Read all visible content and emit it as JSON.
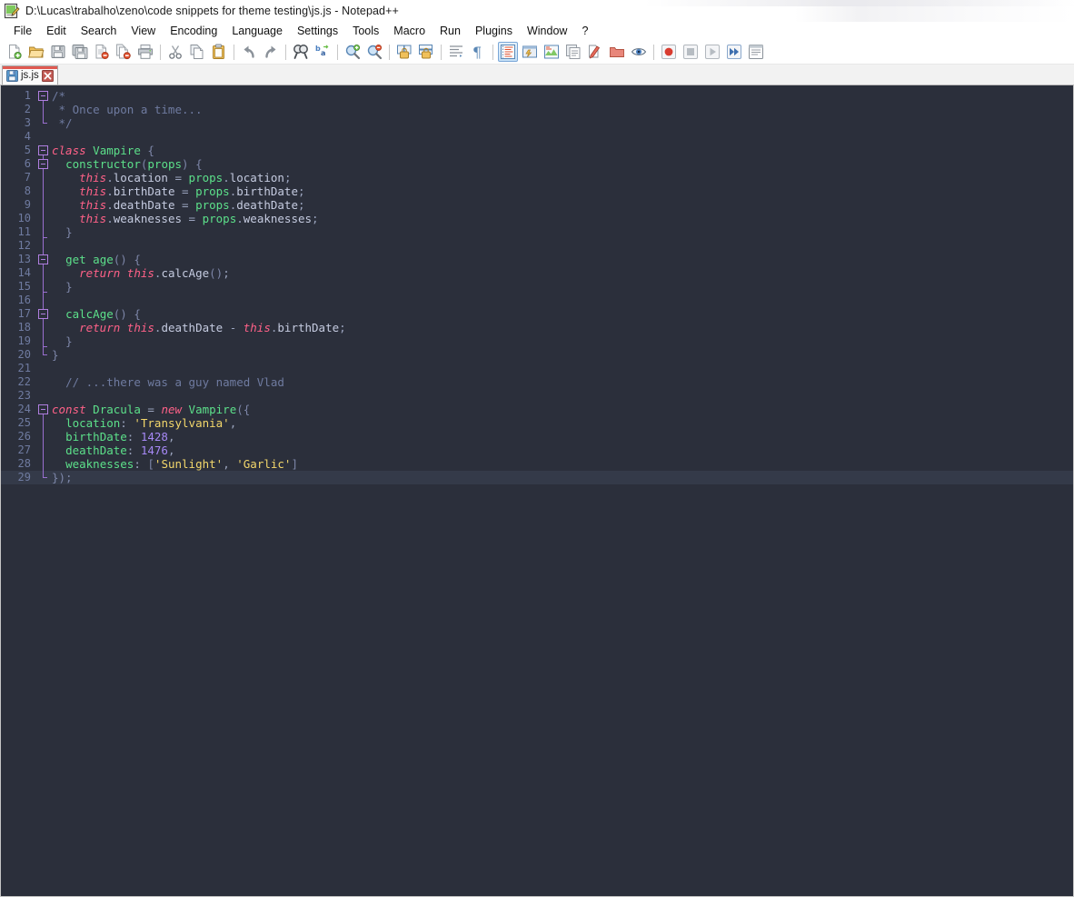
{
  "window": {
    "title": "D:\\Lucas\\trabalho\\zeno\\code snippets for theme testing\\js.js - Notepad++",
    "app_icon": "notepad-pencil-icon"
  },
  "menubar": {
    "items": [
      {
        "label": "File"
      },
      {
        "label": "Edit"
      },
      {
        "label": "Search"
      },
      {
        "label": "View"
      },
      {
        "label": "Encoding"
      },
      {
        "label": "Language"
      },
      {
        "label": "Settings"
      },
      {
        "label": "Tools"
      },
      {
        "label": "Macro"
      },
      {
        "label": "Run"
      },
      {
        "label": "Plugins"
      },
      {
        "label": "Window"
      },
      {
        "label": "?"
      }
    ]
  },
  "toolbar": {
    "buttons": [
      {
        "name": "new-file-icon",
        "title": "New"
      },
      {
        "name": "open-file-icon",
        "title": "Open"
      },
      {
        "name": "save-icon",
        "title": "Save"
      },
      {
        "name": "save-all-icon",
        "title": "Save All"
      },
      {
        "name": "close-file-icon",
        "title": "Close"
      },
      {
        "name": "close-all-icon",
        "title": "Close All"
      },
      {
        "name": "print-icon",
        "title": "Print"
      },
      {
        "name": "separator-1",
        "title": ""
      },
      {
        "name": "cut-icon",
        "title": "Cut"
      },
      {
        "name": "copy-icon",
        "title": "Copy"
      },
      {
        "name": "paste-icon",
        "title": "Paste"
      },
      {
        "name": "separator-2",
        "title": ""
      },
      {
        "name": "undo-icon",
        "title": "Undo"
      },
      {
        "name": "redo-icon",
        "title": "Redo"
      },
      {
        "name": "separator-3",
        "title": ""
      },
      {
        "name": "find-icon",
        "title": "Find"
      },
      {
        "name": "replace-icon",
        "title": "Replace"
      },
      {
        "name": "separator-4",
        "title": ""
      },
      {
        "name": "zoom-in-icon",
        "title": "Zoom In"
      },
      {
        "name": "zoom-out-icon",
        "title": "Zoom Out"
      },
      {
        "name": "separator-5",
        "title": ""
      },
      {
        "name": "sync-vertical-scroll-icon",
        "title": "Synchronize Vertical Scrolling"
      },
      {
        "name": "sync-horizontal-scroll-icon",
        "title": "Synchronize Horizontal Scrolling"
      },
      {
        "name": "separator-6",
        "title": ""
      },
      {
        "name": "word-wrap-icon",
        "title": "Word wrap"
      },
      {
        "name": "show-all-characters-icon",
        "title": "Show All Characters"
      },
      {
        "name": "separator-7",
        "title": ""
      },
      {
        "name": "indent-guide-icon",
        "title": "Show Indent Guide"
      },
      {
        "name": "user-defined-dialog-icon",
        "title": "User Defined Dialogue"
      },
      {
        "name": "document-map-icon",
        "title": "Document Map"
      },
      {
        "name": "function-list-icon",
        "title": "Function List"
      },
      {
        "name": "folder-workspace-icon",
        "title": "Folder as Workspace"
      },
      {
        "name": "monitoring-icon",
        "title": "Monitoring"
      },
      {
        "name": "separator-8",
        "title": ""
      },
      {
        "name": "record-macro-icon",
        "title": "Start Recording"
      },
      {
        "name": "stop-macro-icon",
        "title": "Stop Recording"
      },
      {
        "name": "play-macro-icon",
        "title": "Playback"
      },
      {
        "name": "run-macro-multiple-icon",
        "title": "Run a Macro Multiple Times"
      },
      {
        "name": "save-macro-icon",
        "title": "Save Current Recorded Macro"
      }
    ],
    "active_button": "word-wrap-icon"
  },
  "tabs": [
    {
      "label": "js.js",
      "icon": "save-blue-icon",
      "close": "×",
      "active": true
    }
  ],
  "editor": {
    "current_line": 29,
    "total_lines": 29,
    "lines": [
      {
        "n": 1,
        "fold": "box",
        "tokens": [
          [
            "com",
            "/*"
          ]
        ]
      },
      {
        "n": 2,
        "fold": "line",
        "tokens": [
          [
            "com",
            " * Once upon a time..."
          ]
        ]
      },
      {
        "n": 3,
        "fold": "end",
        "tokens": [
          [
            "com",
            " */"
          ]
        ]
      },
      {
        "n": 4,
        "fold": "none",
        "tokens": []
      },
      {
        "n": 5,
        "fold": "box",
        "tokens": [
          [
            "kw",
            "class"
          ],
          [
            "op",
            " "
          ],
          [
            "id",
            "Vampire"
          ],
          [
            "op",
            " "
          ],
          [
            "punc",
            "{"
          ]
        ]
      },
      {
        "n": 6,
        "fold": "box-line",
        "tokens": [
          [
            "op",
            "  "
          ],
          [
            "id",
            "constructor"
          ],
          [
            "punc",
            "("
          ],
          [
            "id",
            "props"
          ],
          [
            "punc",
            ")"
          ],
          [
            "op",
            " "
          ],
          [
            "punc",
            "{"
          ]
        ]
      },
      {
        "n": 7,
        "fold": "line",
        "tokens": [
          [
            "op",
            "    "
          ],
          [
            "kw",
            "this"
          ],
          [
            "op",
            "."
          ],
          [
            "prop",
            "location"
          ],
          [
            "op",
            " = "
          ],
          [
            "id",
            "props"
          ],
          [
            "op",
            "."
          ],
          [
            "prop",
            "location"
          ],
          [
            "op",
            ";"
          ]
        ]
      },
      {
        "n": 8,
        "fold": "line",
        "tokens": [
          [
            "op",
            "    "
          ],
          [
            "kw",
            "this"
          ],
          [
            "op",
            "."
          ],
          [
            "prop",
            "birthDate"
          ],
          [
            "op",
            " = "
          ],
          [
            "id",
            "props"
          ],
          [
            "op",
            "."
          ],
          [
            "prop",
            "birthDate"
          ],
          [
            "op",
            ";"
          ]
        ]
      },
      {
        "n": 9,
        "fold": "line",
        "tokens": [
          [
            "op",
            "    "
          ],
          [
            "kw",
            "this"
          ],
          [
            "op",
            "."
          ],
          [
            "prop",
            "deathDate"
          ],
          [
            "op",
            " = "
          ],
          [
            "id",
            "props"
          ],
          [
            "op",
            "."
          ],
          [
            "prop",
            "deathDate"
          ],
          [
            "op",
            ";"
          ]
        ]
      },
      {
        "n": 10,
        "fold": "line",
        "tokens": [
          [
            "op",
            "    "
          ],
          [
            "kw",
            "this"
          ],
          [
            "op",
            "."
          ],
          [
            "prop",
            "weaknesses"
          ],
          [
            "op",
            " = "
          ],
          [
            "id",
            "props"
          ],
          [
            "op",
            "."
          ],
          [
            "prop",
            "weaknesses"
          ],
          [
            "op",
            ";"
          ]
        ]
      },
      {
        "n": 11,
        "fold": "tick",
        "tokens": [
          [
            "op",
            "  "
          ],
          [
            "punc",
            "}"
          ]
        ]
      },
      {
        "n": 12,
        "fold": "line",
        "tokens": []
      },
      {
        "n": 13,
        "fold": "box-line",
        "tokens": [
          [
            "op",
            "  "
          ],
          [
            "id",
            "get age"
          ],
          [
            "punc",
            "()"
          ],
          [
            "op",
            " "
          ],
          [
            "punc",
            "{"
          ]
        ]
      },
      {
        "n": 14,
        "fold": "line",
        "tokens": [
          [
            "op",
            "    "
          ],
          [
            "kw",
            "return"
          ],
          [
            "op",
            " "
          ],
          [
            "kw",
            "this"
          ],
          [
            "op",
            "."
          ],
          [
            "prop",
            "calcAge"
          ],
          [
            "punc",
            "()"
          ],
          [
            "op",
            ";"
          ]
        ]
      },
      {
        "n": 15,
        "fold": "tick",
        "tokens": [
          [
            "op",
            "  "
          ],
          [
            "punc",
            "}"
          ]
        ]
      },
      {
        "n": 16,
        "fold": "line",
        "tokens": []
      },
      {
        "n": 17,
        "fold": "box-line",
        "tokens": [
          [
            "op",
            "  "
          ],
          [
            "id",
            "calcAge"
          ],
          [
            "punc",
            "()"
          ],
          [
            "op",
            " "
          ],
          [
            "punc",
            "{"
          ]
        ]
      },
      {
        "n": 18,
        "fold": "line",
        "tokens": [
          [
            "op",
            "    "
          ],
          [
            "kw",
            "return"
          ],
          [
            "op",
            " "
          ],
          [
            "kw",
            "this"
          ],
          [
            "op",
            "."
          ],
          [
            "prop",
            "deathDate"
          ],
          [
            "op",
            " - "
          ],
          [
            "kw",
            "this"
          ],
          [
            "op",
            "."
          ],
          [
            "prop",
            "birthDate"
          ],
          [
            "op",
            ";"
          ]
        ]
      },
      {
        "n": 19,
        "fold": "tick",
        "tokens": [
          [
            "op",
            "  "
          ],
          [
            "punc",
            "}"
          ]
        ]
      },
      {
        "n": 20,
        "fold": "end",
        "tokens": [
          [
            "punc",
            "}"
          ]
        ]
      },
      {
        "n": 21,
        "fold": "none",
        "tokens": []
      },
      {
        "n": 22,
        "fold": "none",
        "tokens": [
          [
            "op",
            "  "
          ],
          [
            "com",
            "// ...there was a guy named Vlad"
          ]
        ]
      },
      {
        "n": 23,
        "fold": "none",
        "tokens": []
      },
      {
        "n": 24,
        "fold": "box",
        "tokens": [
          [
            "kw",
            "const"
          ],
          [
            "op",
            " "
          ],
          [
            "id",
            "Dracula"
          ],
          [
            "op",
            " = "
          ],
          [
            "kw",
            "new"
          ],
          [
            "op",
            " "
          ],
          [
            "id",
            "Vampire"
          ],
          [
            "punc",
            "({"
          ]
        ]
      },
      {
        "n": 25,
        "fold": "line",
        "tokens": [
          [
            "op",
            "  "
          ],
          [
            "id",
            "location"
          ],
          [
            "op",
            ": "
          ],
          [
            "str",
            "'Transylvania'"
          ],
          [
            "op",
            ","
          ]
        ]
      },
      {
        "n": 26,
        "fold": "line",
        "tokens": [
          [
            "op",
            "  "
          ],
          [
            "id",
            "birthDate"
          ],
          [
            "op",
            ": "
          ],
          [
            "num",
            "1428"
          ],
          [
            "op",
            ","
          ]
        ]
      },
      {
        "n": 27,
        "fold": "line",
        "tokens": [
          [
            "op",
            "  "
          ],
          [
            "id",
            "deathDate"
          ],
          [
            "op",
            ": "
          ],
          [
            "num",
            "1476"
          ],
          [
            "op",
            ","
          ]
        ]
      },
      {
        "n": 28,
        "fold": "line",
        "tokens": [
          [
            "op",
            "  "
          ],
          [
            "id",
            "weaknesses"
          ],
          [
            "op",
            ": "
          ],
          [
            "punc",
            "["
          ],
          [
            "str",
            "'Sunlight'"
          ],
          [
            "op",
            ", "
          ],
          [
            "str",
            "'Garlic'"
          ],
          [
            "punc",
            "]"
          ]
        ]
      },
      {
        "n": 29,
        "fold": "end",
        "tokens": [
          [
            "punc",
            "});"
          ]
        ]
      }
    ]
  },
  "colors": {
    "editor_background": "#2b2f3b",
    "current_line_background": "#343a49",
    "line_number": "#6f7ba0",
    "keyword": "#ff6188",
    "identifier": "#5ce08a",
    "string": "#f3d76b",
    "number": "#a688f5",
    "comment": "#6f7ba0",
    "operator": "#9aa3bd",
    "fold_marker": "#b07fe0",
    "tab_active_stripe": "#e05a52"
  }
}
